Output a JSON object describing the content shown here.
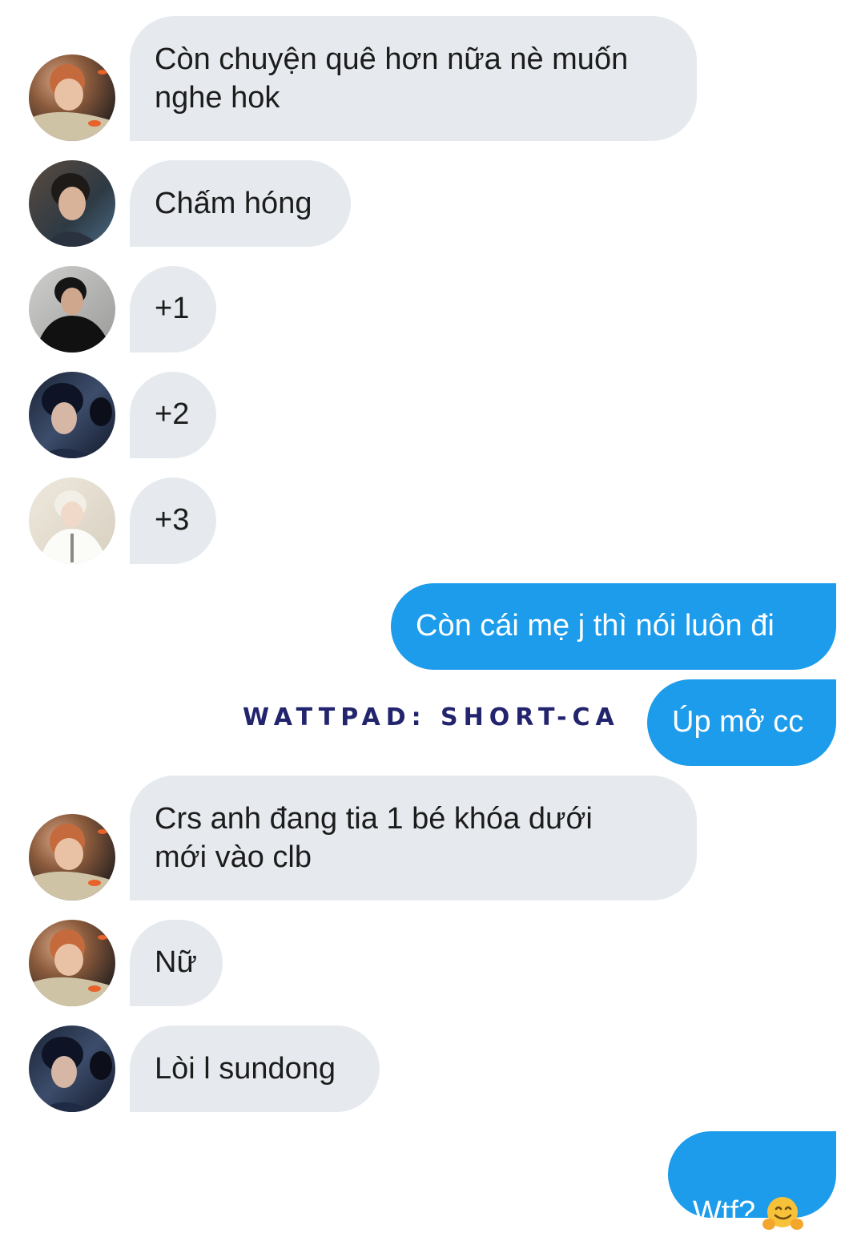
{
  "messages": [
    {
      "sender": "incoming",
      "avatar": "avatar-redhair-goldfish",
      "text": "Còn chuyện quê hơn nữa nè muốn\nnghe hok"
    },
    {
      "sender": "incoming",
      "avatar": "avatar-darkhair-portrait",
      "text": "Chấm hóng"
    },
    {
      "sender": "incoming",
      "avatar": "avatar-black-shirt",
      "text": "+1"
    },
    {
      "sender": "incoming",
      "avatar": "avatar-navy-hair",
      "text": "+2"
    },
    {
      "sender": "incoming",
      "avatar": "avatar-blond-white-shirt",
      "text": "+3"
    },
    {
      "sender": "outgoing",
      "text": "Còn cái mẹ j thì nói luôn đi"
    },
    {
      "sender": "outgoing",
      "text": "Úp mở cc"
    },
    {
      "sender": "incoming",
      "avatar": "avatar-redhair-goldfish",
      "text": "Crs anh đang tia 1 bé khóa dưới\nmới vào clb"
    },
    {
      "sender": "incoming",
      "avatar": "avatar-redhair-goldfish",
      "text": "Nữ"
    },
    {
      "sender": "incoming",
      "avatar": "avatar-navy-hair",
      "text": "Lòi l sundong"
    },
    {
      "sender": "outgoing",
      "text": "Wtf?",
      "emoji": "hugging-face-icon"
    }
  ],
  "watermark": "WATTPAD: SHORT-CA",
  "colors": {
    "background": "#ffffff",
    "incoming_bubble": "#e6eaee",
    "incoming_text": "#1c1c1c",
    "outgoing_bubble": "#1c9ceb",
    "outgoing_text": "#ffffff",
    "watermark": "#23246e"
  }
}
